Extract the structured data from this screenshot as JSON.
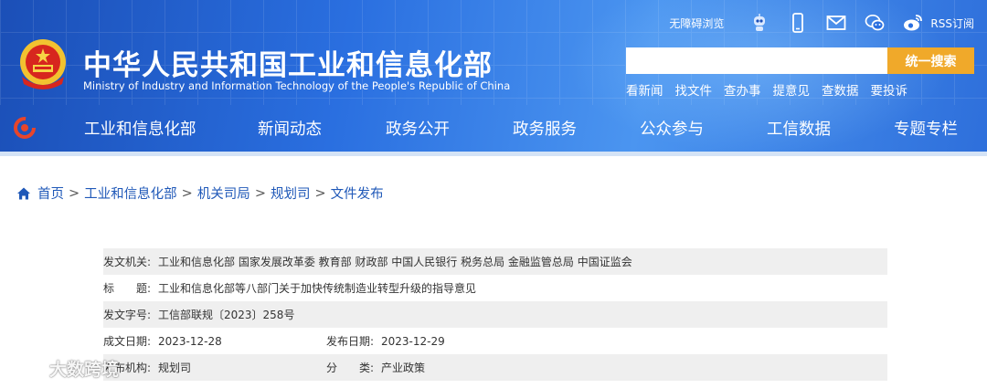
{
  "header": {
    "title": "中华人民共和国工业和信息化部",
    "subtitle": "Ministry of Industry and Information Technology of the People's Republic of China",
    "accessibility": "无障碍浏览",
    "rss": "RSS订阅",
    "search_placeholder": "",
    "search_button": "统一搜索",
    "quick_links": [
      "看新闻",
      "找文件",
      "查办事",
      "提意见",
      "查数据",
      "要投诉"
    ],
    "colors": {
      "header_blue": "#2a6fe0",
      "search_orange": "#f0a92a"
    }
  },
  "nav": {
    "items": [
      "工业和信息化部",
      "新闻动态",
      "政务公开",
      "政务服务",
      "公众参与",
      "工信数据",
      "专题专栏"
    ]
  },
  "breadcrumb": [
    "首页",
    "工业和信息化部",
    "机关司局",
    "规划司",
    "文件发布"
  ],
  "document_info": {
    "issuer_label": "发文机关:",
    "issuer": "工业和信息化部 国家发展改革委 教育部 财政部 中国人民银行 税务总局 金融监管总局 中国证监会",
    "title_label": "标　　题:",
    "title": "工业和信息化部等八部门关于加快传统制造业转型升级的指导意见",
    "doc_no_label": "发文字号:",
    "doc_no": "工信部联规〔2023〕258号",
    "written_date_label": "成文日期:",
    "written_date": "2023-12-28",
    "publish_date_label": "发布日期:",
    "publish_date": "2023-12-29",
    "org_label": "发布机构:",
    "org": "规划司",
    "category_label": "分　　类:",
    "category": "产业政策"
  },
  "watermark": "大数跨境"
}
